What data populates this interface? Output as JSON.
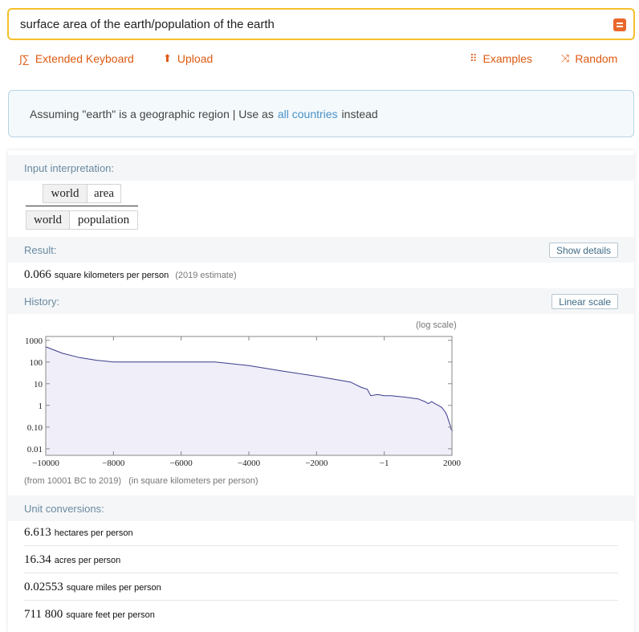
{
  "search": {
    "query": "surface area of the earth/population of the earth"
  },
  "toolbar": {
    "extended_keyboard": "Extended Keyboard",
    "upload": "Upload",
    "examples": "Examples",
    "random": "Random",
    "accent_color": "#dd5a12"
  },
  "assumption": {
    "prefix": "Assuming \"earth\" is a geographic region | Use as",
    "link": "all countries",
    "suffix": "instead"
  },
  "pods": {
    "input_interpretation": {
      "title": "Input interpretation:",
      "numerator": [
        "world",
        "area"
      ],
      "denominator": [
        "world",
        "population"
      ]
    },
    "result": {
      "title": "Result:",
      "button": "Show details",
      "value": "0.066",
      "unit": "square kilometers per person",
      "note": "(2019 estimate)"
    },
    "history": {
      "title": "History:",
      "button": "Linear scale",
      "scale_note": "(log scale)",
      "range_note": "(from 10001 BC to 2019)",
      "unit_note": "(in square kilometers per person)"
    },
    "unit_conversions": {
      "title": "Unit conversions:",
      "rows": [
        {
          "value": "6.613",
          "unit": "hectares per person"
        },
        {
          "value": "16.34",
          "unit": "acres per person"
        },
        {
          "value": "0.02553",
          "unit": "square miles per person"
        },
        {
          "value": "711 800",
          "unit": "square feet per person"
        }
      ]
    }
  },
  "chart_data": {
    "type": "area",
    "log_y": true,
    "xlim": [
      -10000,
      2000
    ],
    "ylim": [
      0.005,
      1500
    ],
    "x_ticks": [
      "−10000",
      "−8000",
      "−6000",
      "−4000",
      "−2000",
      "−1",
      "2000"
    ],
    "y_ticks": [
      "1000",
      "100",
      "10",
      "1",
      "0.10",
      "0.01"
    ],
    "x_tick_values": [
      -10000,
      -8000,
      -6000,
      -4000,
      -2000,
      0,
      2000
    ],
    "y_tick_values": [
      1000,
      100,
      10,
      1,
      0.1,
      0.01
    ],
    "line_color": "#3b3b8c",
    "fill_color": "#efeef9",
    "series": [
      {
        "x": [
          -10000,
          -9500,
          -9000,
          -8500,
          -8000,
          -7000,
          -6000,
          -5000,
          -4000,
          -3000,
          -2000,
          -1000,
          -700,
          -500,
          -400,
          -200,
          0,
          200,
          400,
          600,
          800,
          1000,
          1200,
          1300,
          1400,
          1500,
          1600,
          1700,
          1800,
          1850,
          1900,
          1950,
          1975,
          2000,
          2019
        ],
        "y": [
          500,
          250,
          160,
          120,
          100,
          100,
          100,
          100,
          68,
          38,
          22,
          12,
          7,
          5.5,
          2.8,
          3.2,
          2.8,
          2.8,
          2.6,
          2.4,
          2.2,
          2.0,
          1.5,
          1.2,
          1.5,
          1.2,
          1.0,
          0.8,
          0.5,
          0.35,
          0.2,
          0.12,
          0.08,
          0.07,
          0.066
        ]
      }
    ]
  }
}
